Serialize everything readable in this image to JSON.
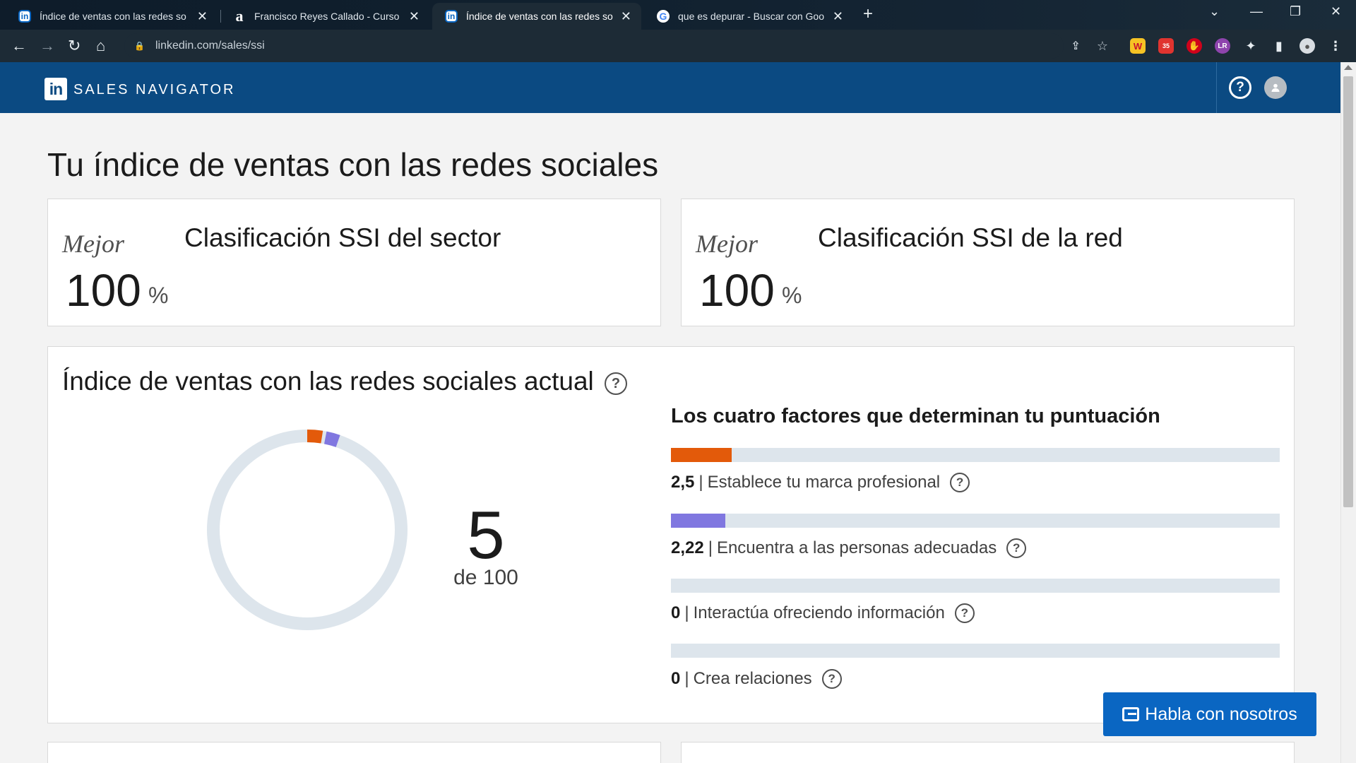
{
  "browser": {
    "tabs": [
      {
        "title": "Índice de ventas con las redes so",
        "favicon": "linkedin-icon",
        "active": false
      },
      {
        "title": "Francisco Reyes Callado - Curso",
        "favicon": "amazon-icon",
        "active": false
      },
      {
        "title": "Índice de ventas con las redes so",
        "favicon": "linkedin-icon",
        "active": true
      },
      {
        "title": "que es depurar - Buscar con Goo",
        "favicon": "google-icon",
        "active": false
      }
    ],
    "close_glyph": "✕",
    "new_tab_glyph": "+",
    "url": "linkedin.com/sales/ssi",
    "extension_badge": "35"
  },
  "header": {
    "logo_text": "in",
    "brand": "SALES NAVIGATOR",
    "help_glyph": "?"
  },
  "page": {
    "title": "Tu índice de ventas con las redes sociales"
  },
  "rankings": [
    {
      "best_label": "Mejor",
      "title": "Clasificación SSI del sector",
      "value": "100",
      "unit": "%"
    },
    {
      "best_label": "Mejor",
      "title": "Clasificación SSI de la red",
      "value": "100",
      "unit": "%"
    }
  ],
  "ssi": {
    "title": "Índice de ventas con las redes sociales actual",
    "score": "5",
    "out_of": "de 100",
    "factors_title": "Los cuatro factores que determinan tu puntuación",
    "factors": [
      {
        "value": "2,5",
        "label": "Establece tu marca profesional",
        "fraction": 0.1,
        "color": "#e35a0a"
      },
      {
        "value": "2,22",
        "label": "Encuentra a las personas adecuadas",
        "fraction": 0.0888,
        "color": "#8077e0"
      },
      {
        "value": "0",
        "label": "Interactúa ofreciendo información",
        "fraction": 0,
        "color": "#56b86b"
      },
      {
        "value": "0",
        "label": "Crea relaciones",
        "fraction": 0,
        "color": "#2a8ec9"
      }
    ],
    "separator": "|"
  },
  "chat": {
    "label": "Habla con nosotros"
  },
  "colors": {
    "brand": "#0b4a82",
    "accent": "#0a66c2",
    "track": "#dde5ec"
  }
}
